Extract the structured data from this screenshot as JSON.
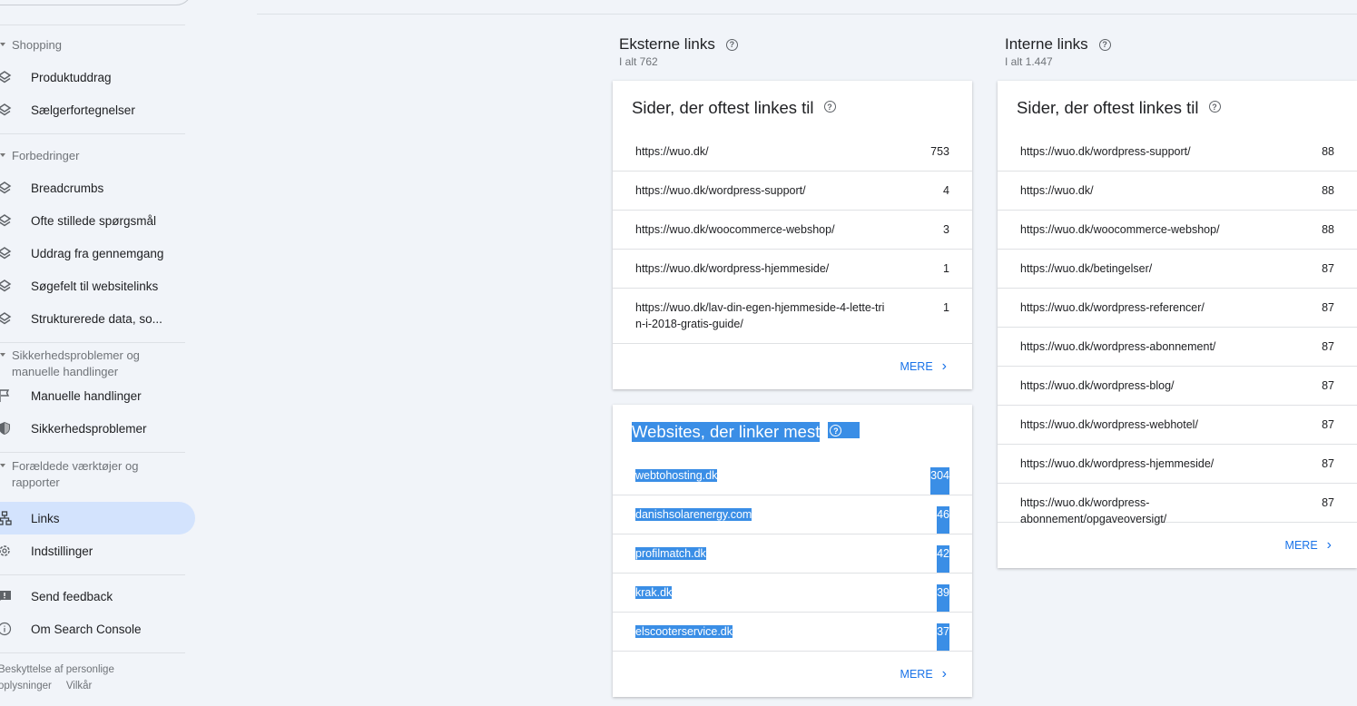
{
  "sidebar": {
    "sections": [
      {
        "label": "Shopping",
        "items": [
          {
            "label": "Produktuddrag",
            "icon": "layers-icon"
          },
          {
            "label": "Sælgerfortegnelser",
            "icon": "layers-icon"
          }
        ]
      },
      {
        "label": "Forbedringer",
        "items": [
          {
            "label": "Breadcrumbs",
            "icon": "layers-icon"
          },
          {
            "label": "Ofte stillede spørgsmål",
            "icon": "layers-icon"
          },
          {
            "label": "Uddrag fra gennemgang",
            "icon": "layers-icon"
          },
          {
            "label": "Søgefelt til websitelinks",
            "icon": "layers-icon"
          },
          {
            "label": "Strukturerede data, so...",
            "icon": "layers-icon"
          }
        ]
      },
      {
        "label": "Sikkerhedsproblemer og manuelle handlinger",
        "items": [
          {
            "label": "Manuelle handlinger",
            "icon": "flag-icon"
          },
          {
            "label": "Sikkerhedsproblemer",
            "icon": "shield-icon"
          }
        ]
      },
      {
        "label": "Forældede værktøjer og rapporter"
      }
    ],
    "links": {
      "label": "Links",
      "icon": "sitemap-icon"
    },
    "settings": {
      "label": "Indstillinger",
      "icon": "gear-icon"
    },
    "feedback": {
      "label": "Send feedback",
      "icon": "feedback-icon"
    },
    "about": {
      "label": "Om Search Console",
      "icon": "info-icon"
    },
    "footer": {
      "privacy": "Beskyttelse af personlige oplysninger",
      "terms": "Vilkår"
    }
  },
  "external": {
    "title": "Eksterne links",
    "total": "I alt 762",
    "top_pages": {
      "title": "Sider, der oftest linkes til",
      "more": "MERE",
      "rows": [
        {
          "url": "https://wuo.dk/",
          "count": "753"
        },
        {
          "url": "https://wuo.dk/wordpress-support/",
          "count": "4"
        },
        {
          "url": "https://wuo.dk/woocommerce-webshop/",
          "count": "3"
        },
        {
          "url": "https://wuo.dk/wordpress-hjemmeside/",
          "count": "1"
        },
        {
          "url": "https://wuo.dk/lav-din-egen-hjemmeside-4-lette-trin-i-2018-gratis-guide/",
          "count": "1"
        }
      ]
    },
    "top_sites": {
      "title": "Websites, der linker mest",
      "more": "MERE",
      "selection_color": "#3a8ee6",
      "rows": [
        {
          "url": "webtohosting.dk",
          "count": "304"
        },
        {
          "url": "danishsolarenergy.com",
          "count": "46"
        },
        {
          "url": "profilmatch.dk",
          "count": "42"
        },
        {
          "url": "krak.dk",
          "count": "39"
        },
        {
          "url": "elscooterservice.dk",
          "count": "37"
        }
      ]
    }
  },
  "internal": {
    "title": "Interne links",
    "total": "I alt 1.447",
    "top_pages": {
      "title": "Sider, der oftest linkes til",
      "more": "MERE",
      "rows": [
        {
          "url": "https://wuo.dk/wordpress-support/",
          "count": "88"
        },
        {
          "url": "https://wuo.dk/",
          "count": "88"
        },
        {
          "url": "https://wuo.dk/woocommerce-webshop/",
          "count": "88"
        },
        {
          "url": "https://wuo.dk/betingelser/",
          "count": "87"
        },
        {
          "url": "https://wuo.dk/wordpress-referencer/",
          "count": "87"
        },
        {
          "url": "https://wuo.dk/wordpress-abonnement/",
          "count": "87"
        },
        {
          "url": "https://wuo.dk/wordpress-blog/",
          "count": "87"
        },
        {
          "url": "https://wuo.dk/wordpress-webhotel/",
          "count": "87"
        },
        {
          "url": "https://wuo.dk/wordpress-hjemmeside/",
          "count": "87"
        },
        {
          "url": "https://wuo.dk/wordpress-abonnement/opgaveoversigt/",
          "count": "87"
        }
      ]
    }
  }
}
